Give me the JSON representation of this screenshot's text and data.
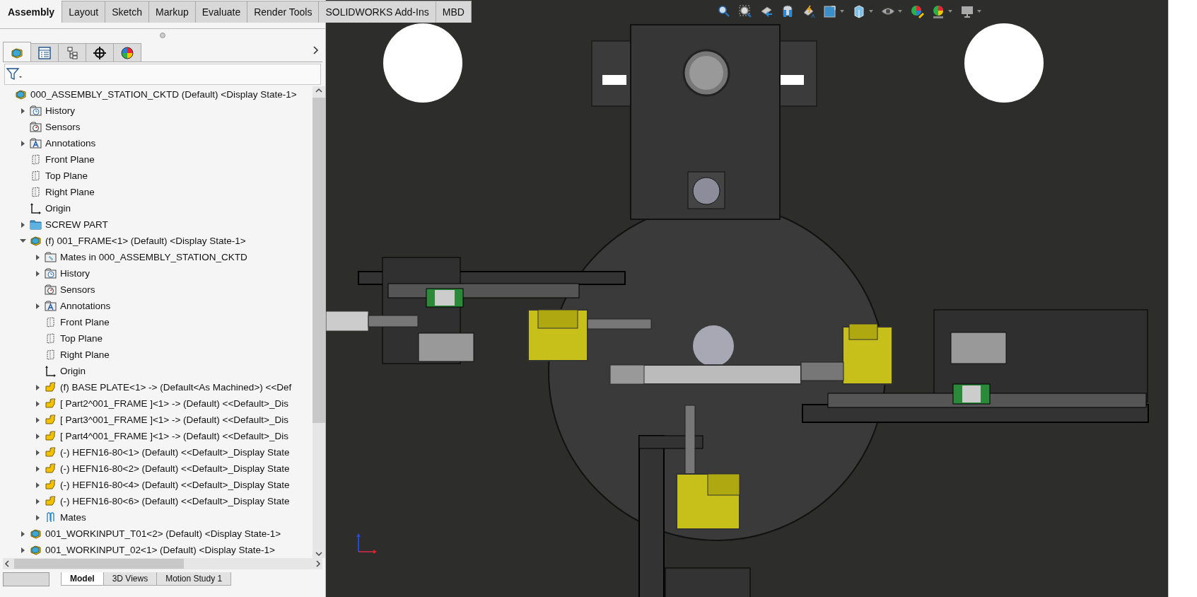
{
  "ribbon_tabs": [
    {
      "label": "Assembly",
      "selected": true
    },
    {
      "label": "Layout",
      "selected": false
    },
    {
      "label": "Sketch",
      "selected": false
    },
    {
      "label": "Markup",
      "selected": false
    },
    {
      "label": "Evaluate",
      "selected": false
    },
    {
      "label": "Render Tools",
      "selected": false
    },
    {
      "label": "SOLIDWORKS Add-Ins",
      "selected": false
    },
    {
      "label": "MBD",
      "selected": false
    }
  ],
  "panel_tabs": [
    {
      "kind": "feature",
      "selected": true
    },
    {
      "kind": "property",
      "selected": false
    },
    {
      "kind": "configuration",
      "selected": false
    },
    {
      "kind": "dimxpert",
      "selected": false
    },
    {
      "kind": "display",
      "selected": false
    }
  ],
  "feature_tree": {
    "label": "000_ASSEMBLY_STATION_CKTD (Default) <Display State-1>",
    "kind": "assembly",
    "children": [
      {
        "label": "History",
        "kind": "history",
        "expanded": false
      },
      {
        "label": "Sensors",
        "kind": "sensors"
      },
      {
        "label": "Annotations",
        "kind": "annotations",
        "expanded": false
      },
      {
        "label": "Front Plane",
        "kind": "plane"
      },
      {
        "label": "Top Plane",
        "kind": "plane"
      },
      {
        "label": "Right Plane",
        "kind": "plane"
      },
      {
        "label": "Origin",
        "kind": "origin"
      },
      {
        "label": "SCREW PART",
        "kind": "folder",
        "expanded": false
      },
      {
        "label": "(f) 001_FRAME<1> (Default) <Display State-1>",
        "kind": "assembly",
        "expanded": true,
        "children": [
          {
            "label": "Mates in 000_ASSEMBLY_STATION_CKTD",
            "kind": "mates_folder",
            "expanded": false
          },
          {
            "label": "History",
            "kind": "history",
            "expanded": false
          },
          {
            "label": "Sensors",
            "kind": "sensors"
          },
          {
            "label": "Annotations",
            "kind": "annotations",
            "expanded": false
          },
          {
            "label": "Front Plane",
            "kind": "plane"
          },
          {
            "label": "Top Plane",
            "kind": "plane"
          },
          {
            "label": "Right Plane",
            "kind": "plane"
          },
          {
            "label": "Origin",
            "kind": "origin"
          },
          {
            "label": "(f) BASE PLATE<1> -> (Default<As Machined>) <<Def",
            "kind": "part",
            "expanded": false
          },
          {
            "label": "[ Part2^001_FRAME ]<1> -> (Default) <<Default>_Dis",
            "kind": "part",
            "expanded": false
          },
          {
            "label": "[ Part3^001_FRAME ]<1> -> (Default) <<Default>_Dis",
            "kind": "part",
            "expanded": false
          },
          {
            "label": "[ Part4^001_FRAME ]<1> -> (Default) <<Default>_Dis",
            "kind": "part",
            "expanded": false
          },
          {
            "label": "(-) HEFN16-80<1> (Default) <<Default>_Display State",
            "kind": "part",
            "expanded": false
          },
          {
            "label": "(-) HEFN16-80<2> (Default) <<Default>_Display State",
            "kind": "part",
            "expanded": false
          },
          {
            "label": "(-) HEFN16-80<4> (Default) <<Default>_Display State",
            "kind": "part",
            "expanded": false
          },
          {
            "label": "(-) HEFN16-80<6> (Default) <<Default>_Display State",
            "kind": "part",
            "expanded": false
          },
          {
            "label": "Mates",
            "kind": "mates",
            "expanded": false
          }
        ]
      },
      {
        "label": "001_WORKINPUT_T01<2> (Default) <Display State-1>",
        "kind": "assembly",
        "expanded": false
      },
      {
        "label": "001_WORKINPUT_02<1> (Default) <Display State-1>",
        "kind": "assembly",
        "expanded": false
      }
    ]
  },
  "bottom_tabs": [
    {
      "label": "Model",
      "selected": true
    },
    {
      "label": "3D Views",
      "selected": false
    },
    {
      "label": "Motion Study 1",
      "selected": false
    }
  ]
}
